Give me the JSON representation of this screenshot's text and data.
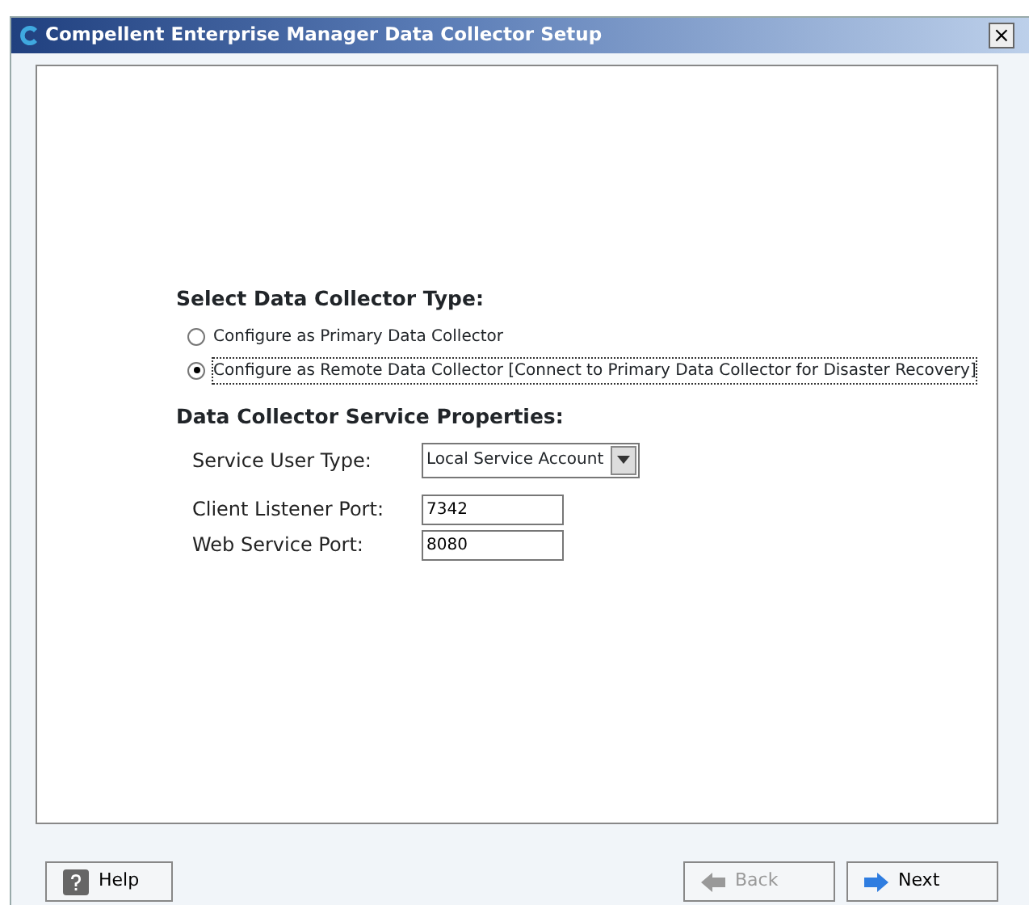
{
  "window": {
    "title": "Compellent Enterprise Manager Data Collector Setup",
    "close": "×"
  },
  "collector_type": {
    "heading": "Select Data Collector Type:",
    "options": [
      {
        "label": "Configure as Primary Data Collector",
        "selected": false
      },
      {
        "label": "Configure as Remote Data Collector [Connect to Primary Data Collector for Disaster Recovery]",
        "selected": true
      }
    ]
  },
  "service_properties": {
    "heading": "Data Collector Service Properties:",
    "fields": [
      {
        "kind": "select",
        "label": "Service User Type:",
        "value": "Local Service Account"
      },
      {
        "kind": "text",
        "label": "Client Listener Port:",
        "value": "7342"
      },
      {
        "kind": "text",
        "label": "Web Service Port:",
        "value": "8080"
      }
    ]
  },
  "buttons": [
    {
      "kind": "help",
      "label": "Help",
      "disabled": false
    },
    {
      "kind": "back",
      "label": "Back",
      "disabled": true
    },
    {
      "kind": "next",
      "label": "Next",
      "disabled": false
    }
  ]
}
